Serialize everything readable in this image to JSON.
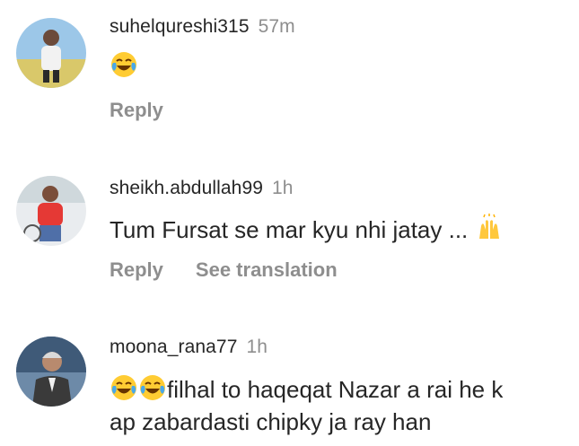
{
  "comments": [
    {
      "username": "suhelqureshi315",
      "time": "57m",
      "text": "",
      "emoji_prefix": [
        "face-with-tears-of-joy"
      ],
      "actions": [
        "Reply"
      ]
    },
    {
      "username": "sheikh.abdullah99",
      "time": "1h",
      "text": "Tum Fursat se mar kyu nhi jatay ...",
      "emoji_suffix": [
        "raising-hands"
      ],
      "actions": [
        "Reply",
        "See translation"
      ]
    },
    {
      "username": "moona_rana77",
      "time": "1h",
      "text_line1": "filhal to haqeqat Nazar a rai he k",
      "text_line2": "ap zabardasti chipky ja ray han",
      "emoji_prefix": [
        "face-with-tears-of-joy",
        "face-with-tears-of-joy"
      ]
    }
  ],
  "colors": {
    "primary_text": "#262626",
    "secondary_text": "#8e8e8e",
    "background": "#ffffff"
  }
}
